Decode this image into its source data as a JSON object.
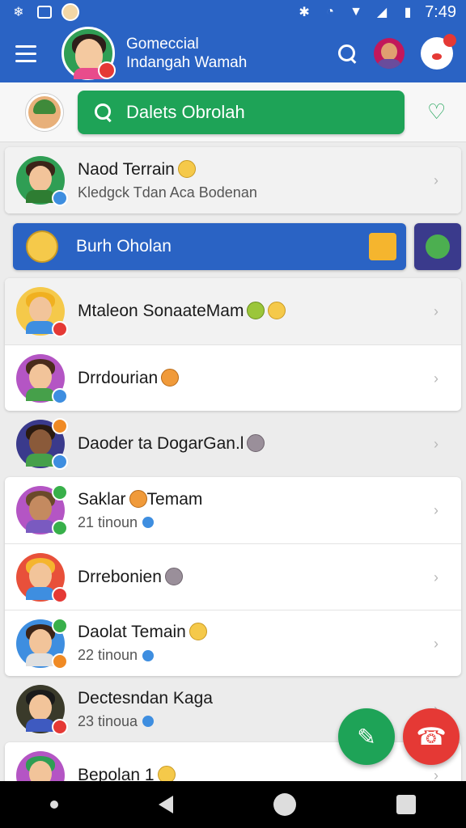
{
  "status_bar": {
    "time": "7:49",
    "icons": [
      "snowflake-icon",
      "gallery-icon",
      "face-icon",
      "bluetooth-icon",
      "alarm-icon",
      "wifi-icon",
      "signal-icon",
      "battery-icon"
    ]
  },
  "header": {
    "title_line1": "Gomeccial",
    "title_line2": "Indangah Wamah"
  },
  "search": {
    "label": "Dalets Obrolah"
  },
  "banner": {
    "label": "Burh Oholan"
  },
  "chats": [
    {
      "name": "Naod Terrain",
      "preview": "Kledgck Tdan Aca Bodenan"
    },
    {
      "name": "Mtaleon SonaateMam",
      "preview": ""
    },
    {
      "name": "Drrdourian",
      "preview": ""
    },
    {
      "name": "Daoder ta DogarGan.l",
      "preview": ""
    },
    {
      "name": "Saklar",
      "name_tail": "Temam",
      "preview": "21 tinoun"
    },
    {
      "name": "Drrebonien",
      "preview": ""
    },
    {
      "name": "Daolat Temain",
      "preview": "22 tinoun"
    },
    {
      "name": "Dectesndan Kaga",
      "preview": "23 tinoua"
    },
    {
      "name": "Bepolan 1",
      "preview": ""
    }
  ],
  "colors": {
    "primary": "#2a63c4",
    "green": "#1ea357",
    "red": "#e53935"
  }
}
